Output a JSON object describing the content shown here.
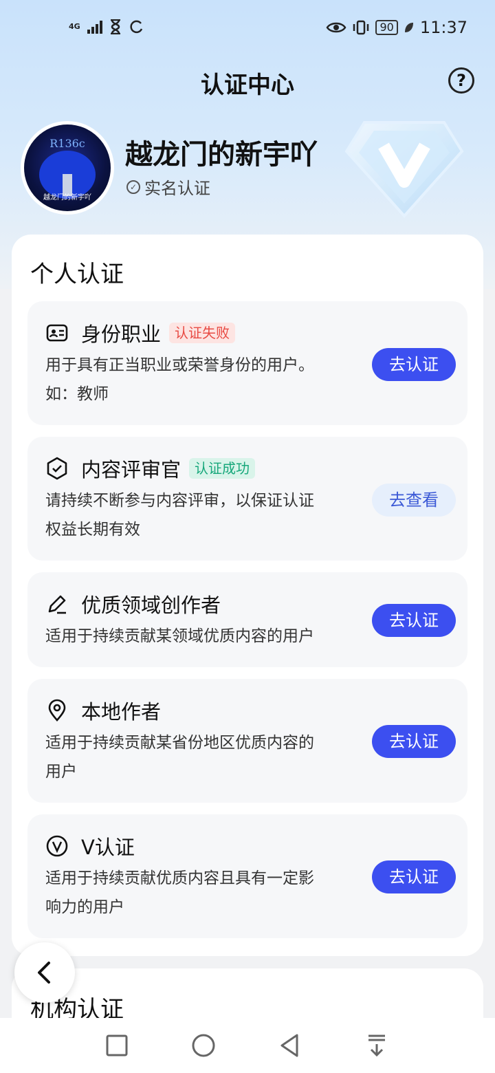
{
  "status_bar": {
    "network": "4G",
    "battery": "90",
    "time": "11:37"
  },
  "header": {
    "title": "认证中心",
    "help_icon": "question-circle-icon"
  },
  "profile": {
    "avatar_text_top": "R136c",
    "avatar_text_bottom": "越龙门的新宇吖",
    "name": "越龙门的新宇吖",
    "verify_label": "实名认证"
  },
  "personal": {
    "title": "个人认证",
    "items": [
      {
        "icon": "id-card-icon",
        "title": "身份职业",
        "tag": "认证失败",
        "desc_line1": "用于具有正当职业或荣誉身份的用户。",
        "desc_line2": "如：教师",
        "button": "去认证"
      },
      {
        "icon": "shield-check-icon",
        "title": "内容评审官",
        "tag": "认证成功",
        "desc_line1": "请持续不断参与内容评审，以保证认证",
        "desc_line2": "权益长期有效",
        "button": "去查看"
      },
      {
        "icon": "pen-icon",
        "title": "优质领域创作者",
        "desc_line1": "适用于持续贡献某领域优质内容的用户",
        "button": "去认证"
      },
      {
        "icon": "location-pin-icon",
        "title": "本地作者",
        "desc_line1": "适用于持续贡献某省份地区优质内容的",
        "desc_line2": "用户",
        "button": "去认证"
      },
      {
        "icon": "v-circle-icon",
        "title": "V认证",
        "desc_line1": "适用于持续贡献优质内容且具有一定影",
        "desc_line2": "响力的用户",
        "button": "去认证"
      }
    ]
  },
  "organization": {
    "title": "机构认证"
  },
  "colors": {
    "primary_button": "#3c4ff0",
    "fail_tag": "#e84a43",
    "success_tag": "#16a77a"
  }
}
